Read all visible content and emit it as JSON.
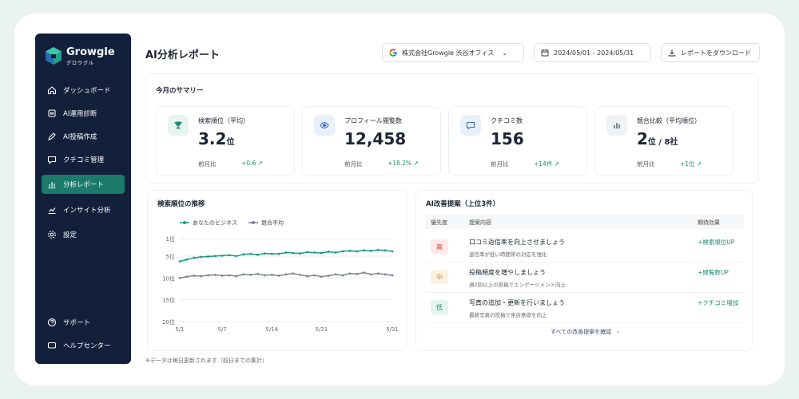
{
  "app": {
    "logo_name": "Growgle",
    "logo_sub": "グロウグル"
  },
  "sidebar": {
    "items": [
      {
        "label": "ダッシュボード",
        "icon": "home-icon"
      },
      {
        "label": "AI運用診断",
        "icon": "ai-icon"
      },
      {
        "label": "AI投稿作成",
        "icon": "pen-icon"
      },
      {
        "label": "クチコミ管理",
        "icon": "message-icon"
      },
      {
        "label": "分析レポート",
        "icon": "bar-chart-icon",
        "active": true
      },
      {
        "label": "インサイト分析",
        "icon": "trend-icon"
      },
      {
        "label": "設定",
        "icon": "gear-icon"
      }
    ],
    "bottom_items": [
      {
        "label": "サポート",
        "icon": "help-icon"
      },
      {
        "label": "ヘルプセンター",
        "icon": "chat-icon"
      }
    ]
  },
  "header": {
    "title": "AI分析レポート",
    "store": "株式会社Growgle 渋谷オフィス",
    "date_range": "2024/05/01 - 2024/05/31",
    "download_label": "レポートをダウンロード"
  },
  "summary": {
    "title": "今月のサマリー",
    "kpis": [
      {
        "label": "検索順位（平均）",
        "value": "3.2",
        "unit": "位",
        "compare_label": "前月比",
        "delta": "+0.6 ↗",
        "icon": "trophy-icon"
      },
      {
        "label": "プロフィール閲覧数",
        "value": "12,458",
        "unit": "",
        "compare_label": "前月比",
        "delta": "+18.2% ↗",
        "icon": "eye-icon"
      },
      {
        "label": "クチコミ数",
        "value": "156",
        "unit": "",
        "compare_label": "前月比",
        "delta": "+14件 ↗",
        "icon": "review-icon"
      },
      {
        "label": "競合比較（平均順位）",
        "value": "2",
        "unit": "位 / 8社",
        "compare_label": "前月比",
        "delta": "+1位 ↗",
        "icon": "compare-icon"
      }
    ]
  },
  "chart_panel": {
    "title": "検索順位の推移"
  },
  "chart_data": {
    "type": "line",
    "title": "検索順位の推移",
    "x_ticks": [
      "5/1",
      "5/7",
      "5/14",
      "5/21",
      "5/31"
    ],
    "y_ticks": [
      "1位",
      "5位",
      "10位",
      "15位",
      "20位"
    ],
    "y_tick_values": [
      1,
      5,
      10,
      15,
      20
    ],
    "ylim": [
      1,
      20
    ],
    "y_inverted": true,
    "legend_position": "top",
    "x": [
      1,
      2,
      3,
      4,
      5,
      6,
      7,
      8,
      9,
      10,
      11,
      12,
      13,
      14,
      15,
      16,
      17,
      18,
      19,
      20,
      21,
      22,
      23,
      24,
      25,
      26,
      27,
      28,
      29,
      30,
      31
    ],
    "series": [
      {
        "name": "あなたのビジネス",
        "color": "#1b9a82",
        "values": [
          6.2,
          5.8,
          5.4,
          5.2,
          5.1,
          5.0,
          4.9,
          4.8,
          5.0,
          4.6,
          4.5,
          4.7,
          4.4,
          4.5,
          4.5,
          4.2,
          4.3,
          4.4,
          4.1,
          4.2,
          4.3,
          4.0,
          4.2,
          3.9,
          3.8,
          3.9,
          3.7,
          3.8,
          3.6,
          3.7,
          3.9
        ]
      },
      {
        "name": "競合平均",
        "color": "#7f8494",
        "values": [
          10.0,
          9.7,
          9.5,
          9.6,
          9.4,
          9.3,
          9.5,
          9.4,
          9.6,
          9.2,
          9.3,
          9.1,
          9.4,
          9.3,
          9.5,
          9.2,
          9.0,
          9.3,
          9.6,
          9.4,
          9.7,
          9.5,
          9.2,
          9.4,
          9.0,
          9.1,
          8.8,
          9.2,
          9.0,
          9.2,
          9.4
        ]
      }
    ]
  },
  "suggestions": {
    "title": "AI改善提案（上位3件）",
    "headers": {
      "priority": "優先度",
      "content": "提案内容",
      "effect": "期待効果"
    },
    "rows": [
      {
        "priority": "高",
        "title": "口コミ返信率を向上させましょう",
        "desc": "返信率が低い時間帯の対応を強化",
        "effect": "+検索順位UP",
        "bg": "#fde8e8",
        "fg": "#d23b3b"
      },
      {
        "priority": "中",
        "title": "投稿頻度を増やしましょう",
        "desc": "週2回以上の投稿でエンゲージメント向上",
        "effect": "+閲覧数UP",
        "bg": "#fdf1e1",
        "fg": "#e08a1e"
      },
      {
        "priority": "低",
        "title": "写真の追加・更新を行いましょう",
        "desc": "最新写真の投稿で来店意欲を向上",
        "effect": "+クチコミ増加",
        "bg": "#e4f4ee",
        "fg": "#1b8a6e"
      }
    ],
    "link": "すべての改善提案を確認　›"
  },
  "footnote": "※データは毎日更新されます（前日までの集計）",
  "colors": {
    "sidebar_bg": "#12203b",
    "accent": "#1b7a6a",
    "positive": "#1b8a6e"
  }
}
